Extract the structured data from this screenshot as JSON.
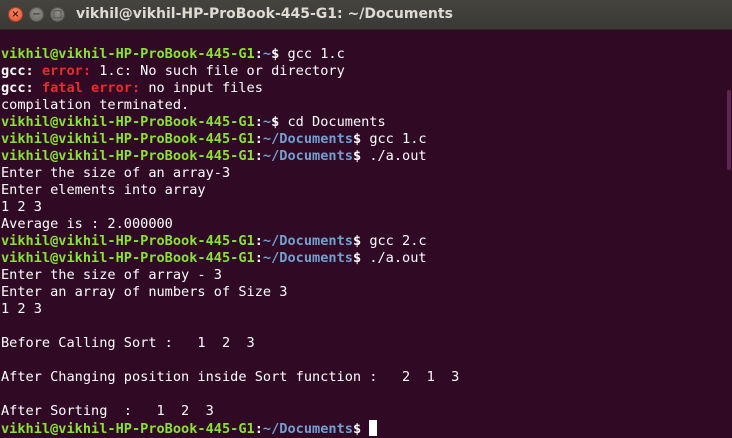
{
  "window": {
    "title": "vikhil@vikhil-HP-ProBook-445-G1: ~/Documents",
    "close_glyph": "×",
    "minimize_glyph": "−",
    "maximize_glyph": "□"
  },
  "terminal": {
    "lines": [
      {
        "type": "prompt",
        "user_host": "vikhil@vikhil-HP-ProBook-445-G1",
        "path": "~",
        "command": "gcc 1.c"
      },
      {
        "type": "error",
        "prefix": "gcc:",
        "kind": "error:",
        "message": "1.c: No such file or directory"
      },
      {
        "type": "error",
        "prefix": "gcc:",
        "kind": "fatal error:",
        "message": "no input files"
      },
      {
        "type": "text",
        "text": "compilation terminated."
      },
      {
        "type": "prompt",
        "user_host": "vikhil@vikhil-HP-ProBook-445-G1",
        "path": "~",
        "command": "cd Documents"
      },
      {
        "type": "prompt",
        "user_host": "vikhil@vikhil-HP-ProBook-445-G1",
        "path": "~/Documents",
        "command": "gcc 1.c"
      },
      {
        "type": "prompt",
        "user_host": "vikhil@vikhil-HP-ProBook-445-G1",
        "path": "~/Documents",
        "command": "./a.out"
      },
      {
        "type": "text",
        "text": "Enter the size of an array-3"
      },
      {
        "type": "text",
        "text": "Enter elements into array"
      },
      {
        "type": "text",
        "text": "1 2 3"
      },
      {
        "type": "text",
        "text": "Average is : 2.000000"
      },
      {
        "type": "prompt",
        "user_host": "vikhil@vikhil-HP-ProBook-445-G1",
        "path": "~/Documents",
        "command": "gcc 2.c"
      },
      {
        "type": "prompt",
        "user_host": "vikhil@vikhil-HP-ProBook-445-G1",
        "path": "~/Documents",
        "command": "./a.out"
      },
      {
        "type": "text",
        "text": "Enter the size of array - 3"
      },
      {
        "type": "text",
        "text": "Enter an array of numbers of Size 3"
      },
      {
        "type": "text",
        "text": "1 2 3"
      },
      {
        "type": "text",
        "text": ""
      },
      {
        "type": "text",
        "text": "Before Calling Sort :   1  2  3"
      },
      {
        "type": "text",
        "text": ""
      },
      {
        "type": "text",
        "text": "After Changing position inside Sort function :   2  1  3"
      },
      {
        "type": "text",
        "text": ""
      },
      {
        "type": "text",
        "text": "After Sorting  :   1  2  3"
      },
      {
        "type": "prompt",
        "user_host": "vikhil@vikhil-HP-ProBook-445-G1",
        "path": "~/Documents",
        "command": "",
        "cursor": true
      }
    ]
  },
  "colors": {
    "background": "#300a24",
    "prompt_user": "#8ae234",
    "prompt_path": "#729fcf",
    "error": "#ef2929",
    "text": "#ffffff"
  }
}
